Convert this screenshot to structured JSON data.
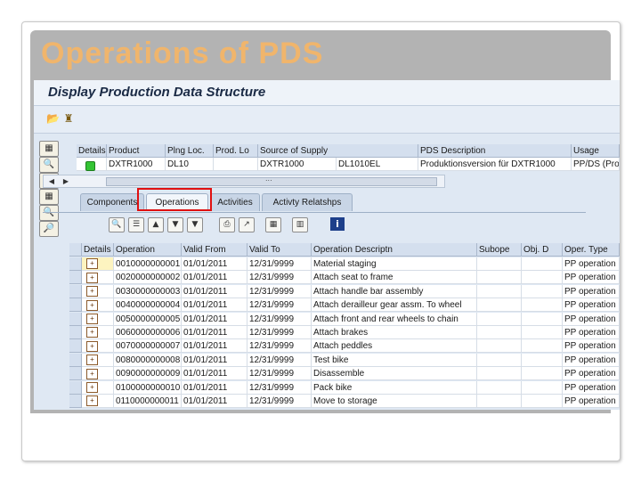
{
  "slide": {
    "title": "Operations of PDS"
  },
  "window": {
    "title": "Display Production Data Structure"
  },
  "toolbar": {
    "icons": [
      "folder-open-icon",
      "pin-icon"
    ]
  },
  "header_table": {
    "columns": [
      "Details",
      "Product",
      "Plng Loc.",
      "Prod. Lo",
      "Source of Supply",
      "PDS Description",
      "Usage"
    ],
    "row": {
      "product": "DXTR1000",
      "plng_loc": "DL10",
      "prod_lo": "",
      "source": "DXTR1000",
      "source2": "DL1010EL",
      "description": "Produktionsversion für DXTR1000",
      "usage": "PP/DS (Pro"
    }
  },
  "scroll_dots": "...",
  "tabs": [
    "Components",
    "Operations",
    "Activities",
    "Activty Relatshps"
  ],
  "operations": {
    "columns": [
      "Details",
      "Operation",
      "Valid From",
      "Valid To",
      "Operation Descriptn",
      "Subope",
      "Obj. D",
      "Oper. Type"
    ],
    "rows": [
      {
        "op": "0010000000001",
        "from": "01/01/2011",
        "to": "12/31/9999",
        "desc": "Material staging",
        "type": "PP operation"
      },
      {
        "op": "0020000000002",
        "from": "01/01/2011",
        "to": "12/31/9999",
        "desc": "Attach seat to frame",
        "type": "PP operation"
      },
      {
        "op": "0030000000003",
        "from": "01/01/2011",
        "to": "12/31/9999",
        "desc": "Attach handle bar assembly",
        "type": "PP operation"
      },
      {
        "op": "0040000000004",
        "from": "01/01/2011",
        "to": "12/31/9999",
        "desc": "Attach derailleur gear assm. To wheel",
        "type": "PP operation"
      },
      {
        "op": "0050000000005",
        "from": "01/01/2011",
        "to": "12/31/9999",
        "desc": "Attach front and rear wheels to chain",
        "type": "PP operation"
      },
      {
        "op": "0060000000006",
        "from": "01/01/2011",
        "to": "12/31/9999",
        "desc": "Attach brakes",
        "type": "PP operation"
      },
      {
        "op": "0070000000007",
        "from": "01/01/2011",
        "to": "12/31/9999",
        "desc": "Attach peddles",
        "type": "PP operation"
      },
      {
        "op": "0080000000008",
        "from": "01/01/2011",
        "to": "12/31/9999",
        "desc": "Test bike",
        "type": "PP operation"
      },
      {
        "op": "0090000000009",
        "from": "01/01/2011",
        "to": "12/31/9999",
        "desc": "Disassemble",
        "type": "PP operation"
      },
      {
        "op": "0100000000010",
        "from": "01/01/2011",
        "to": "12/31/9999",
        "desc": "Pack bike",
        "type": "PP operation"
      },
      {
        "op": "0110000000011",
        "from": "01/01/2011",
        "to": "12/31/9999",
        "desc": "Move to storage",
        "type": "PP operation"
      }
    ]
  },
  "colors": {
    "title_orange": "#f0b56c",
    "highlight_red": "#e01010",
    "header_bg": "#d4dfee"
  }
}
